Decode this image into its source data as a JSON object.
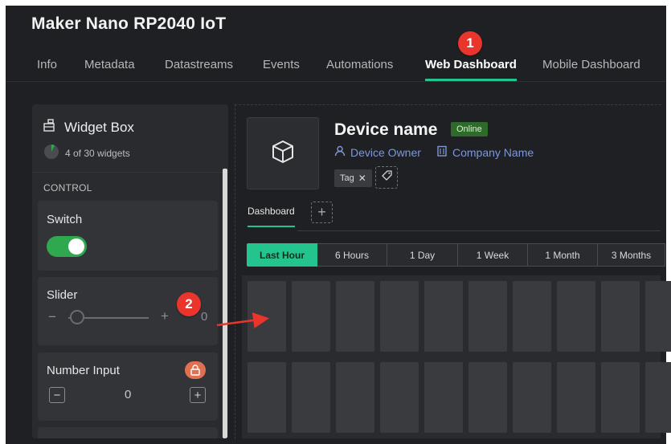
{
  "app": {
    "title": "Maker Nano RP2040 IoT"
  },
  "tabs": [
    {
      "label": "Info",
      "active": false
    },
    {
      "label": "Metadata",
      "active": false
    },
    {
      "label": "Datastreams",
      "active": false
    },
    {
      "label": "Events",
      "active": false
    },
    {
      "label": "Automations",
      "active": false
    },
    {
      "label": "Web Dashboard",
      "active": true
    },
    {
      "label": "Mobile Dashboard",
      "active": false
    }
  ],
  "annotations": {
    "badge1": "1",
    "badge2": "2"
  },
  "widget_box": {
    "title": "Widget Box",
    "count": "4 of 30 widgets",
    "section": "CONTROL",
    "widgets": {
      "switch": {
        "label": "Switch",
        "on": true
      },
      "slider": {
        "label": "Slider",
        "minus": "−",
        "plus": "+",
        "value": "0"
      },
      "number_input": {
        "label": "Number Input",
        "minus": "−",
        "plus": "+",
        "value": "0"
      }
    }
  },
  "dashboard": {
    "device_name": "Device name",
    "status": "Online",
    "owner": "Device Owner",
    "company": "Company Name",
    "tag": "Tag",
    "tab": "Dashboard",
    "add": "+",
    "time_ranges": [
      {
        "label": "Last Hour",
        "active": true
      },
      {
        "label": "6 Hours",
        "active": false
      },
      {
        "label": "1 Day",
        "active": false
      },
      {
        "label": "1 Week",
        "active": false
      },
      {
        "label": "1 Month",
        "active": false
      },
      {
        "label": "3 Months",
        "active": false
      }
    ]
  },
  "colors": {
    "accent": "#23c48e",
    "badge": "#e9352b",
    "toggle_on": "#2fa84f",
    "online_bg": "#2e6a2a",
    "link": "#7f97d6",
    "background": "#1f2023"
  }
}
